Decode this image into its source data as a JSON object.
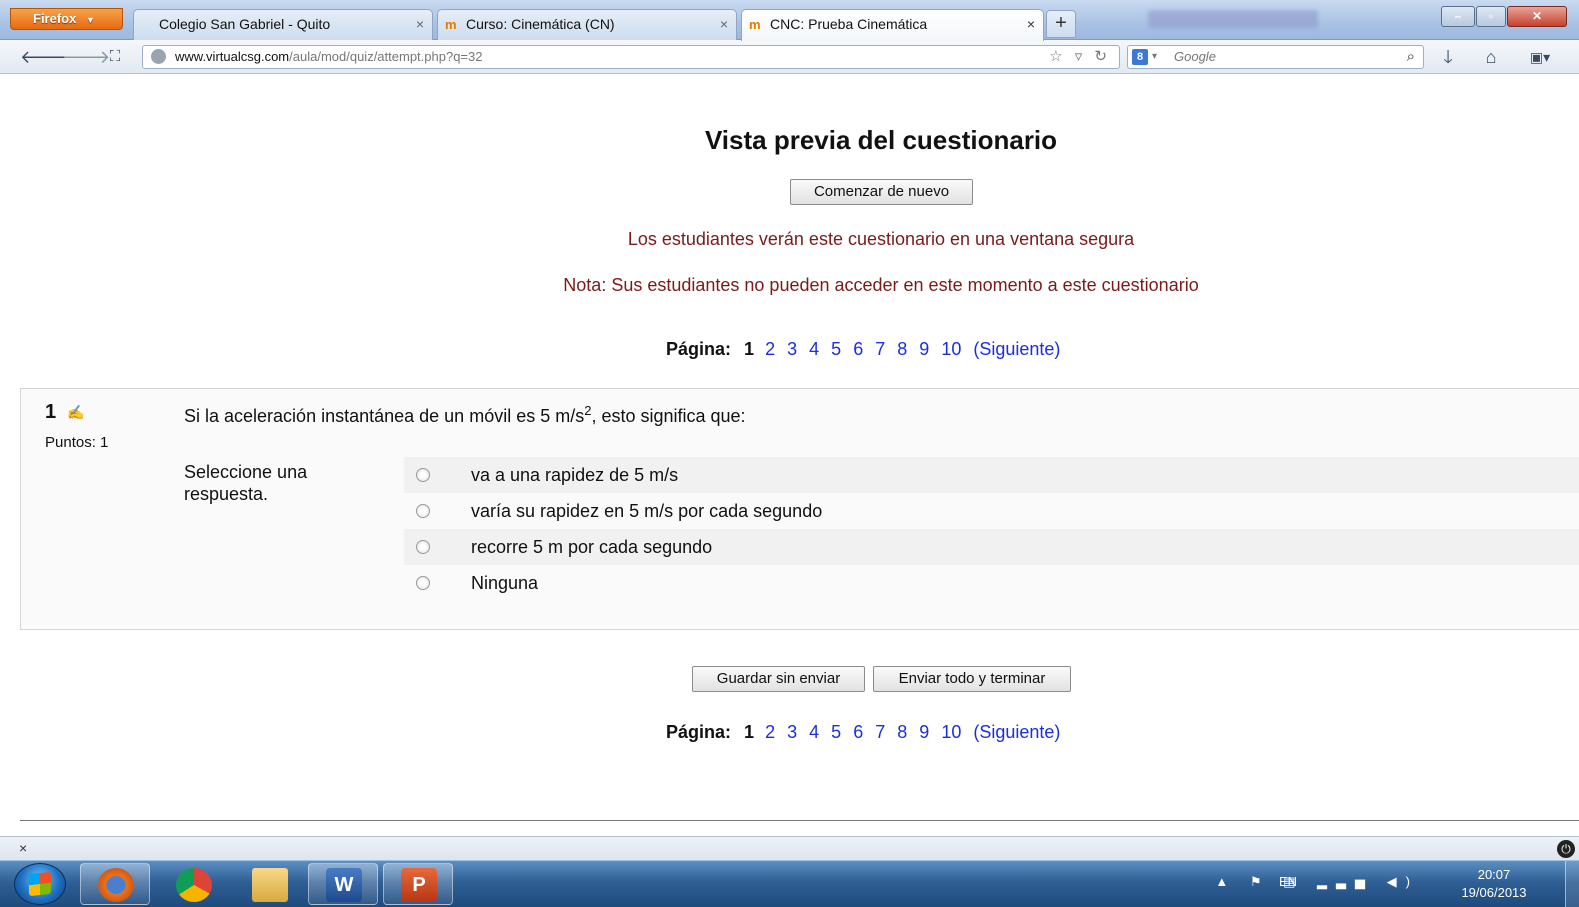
{
  "browser": {
    "menu_button": "Firefox",
    "tabs": [
      {
        "title": "Colegio San Gabriel - Quito",
        "active": false,
        "has_icon": false
      },
      {
        "title": "Curso: Cinemática (CN)",
        "active": false,
        "has_icon": true
      },
      {
        "title": "CNC: Prueba Cinemática",
        "active": true,
        "has_icon": true
      }
    ],
    "tab_icon_glyph": "m",
    "new_tab": "+",
    "url_domain": "www.virtualcsg.com",
    "url_path": "/aula/mod/quiz/attempt.php?q=32",
    "search_placeholder": "Google",
    "search_engine_glyph": "8"
  },
  "page": {
    "title": "Vista previa del cuestionario",
    "restart_button": "Comenzar de nuevo",
    "notice_secure": "Los estudiantes verán este cuestionario en una ventana segura",
    "notice_access": "Nota: Sus estudiantes no pueden acceder en este momento a este cuestionario",
    "pager": {
      "label": "Página:",
      "current": "1",
      "pages": [
        "2",
        "3",
        "4",
        "5",
        "6",
        "7",
        "8",
        "9",
        "10"
      ],
      "next": "(Siguiente)"
    },
    "question": {
      "number": "1",
      "points": "Puntos: 1",
      "text_before": "Si la aceleración instantánea de un móvil es 5 m/s",
      "text_sup": "2",
      "text_after": ", esto significa que:",
      "prompt": "Seleccione una respuesta.",
      "answers": [
        "va a una rapidez de 5 m/s",
        "varía su rapidez en 5 m/s por cada segundo",
        "recorre 5 m por cada segundo",
        "Ninguna"
      ]
    },
    "save_button": "Guardar sin enviar",
    "submit_button": "Enviar todo y terminar"
  },
  "addon_bar": {
    "close": "×"
  },
  "taskbar": {
    "apps": [
      {
        "name": "firefox",
        "color": "#e8721c"
      },
      {
        "name": "chrome",
        "color": "#2f9e44"
      },
      {
        "name": "explorer",
        "color": "#e0b040"
      },
      {
        "name": "word",
        "glyph": "W",
        "color": "#2b5797"
      },
      {
        "name": "powerpoint",
        "glyph": "P",
        "color": "#d24726"
      }
    ],
    "language": "EN",
    "time": "20:07",
    "date": "19/06/2013"
  }
}
